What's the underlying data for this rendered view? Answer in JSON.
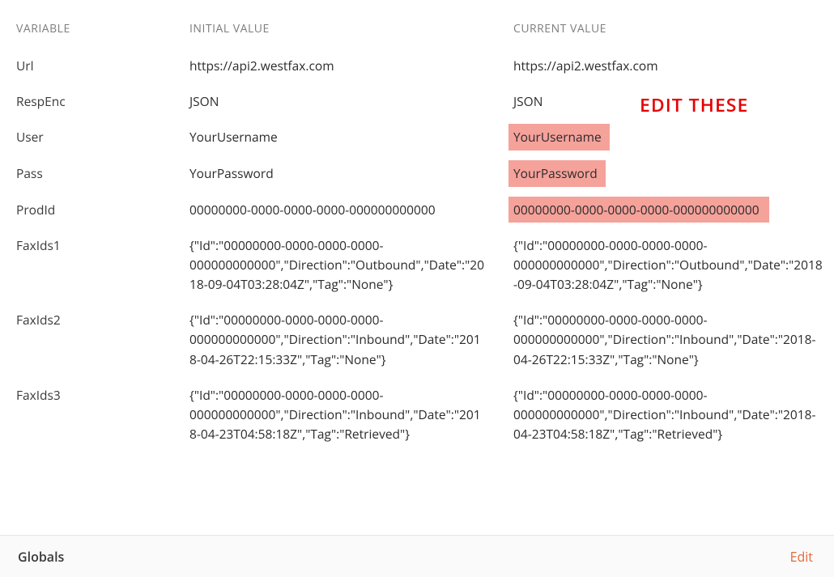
{
  "annotation": "EDIT THESE",
  "headers": {
    "variable": "VARIABLE",
    "initial": "INITIAL VALUE",
    "current": "CURRENT VALUE"
  },
  "rows": [
    {
      "variable": "Url",
      "initial": "https://api2.westfax.com",
      "current": "https://api2.westfax.com",
      "highlight": false
    },
    {
      "variable": "RespEnc",
      "initial": "JSON",
      "current": "JSON",
      "highlight": false
    },
    {
      "variable": "User",
      "initial": "YourUsername",
      "current": "YourUsername",
      "highlight": true
    },
    {
      "variable": "Pass",
      "initial": "YourPassword",
      "current": "YourPassword",
      "highlight": true
    },
    {
      "variable": "ProdId",
      "initial": "00000000-0000-0000-0000-000000000000",
      "current": "00000000-0000-0000-0000-000000000000",
      "highlight": true,
      "wide": true
    },
    {
      "variable": "FaxIds1",
      "initial": "{\"Id\":\"00000000-0000-0000-0000-000000000000\",\"Direction\":\"Outbound\",\"Date\":\"2018-09-04T03:28:04Z\",\"Tag\":\"None\"}",
      "current": "{\"Id\":\"00000000-0000-0000-0000-000000000000\",\"Direction\":\"Outbound\",\"Date\":\"2018-09-04T03:28:04Z\",\"Tag\":\"None\"}",
      "highlight": false
    },
    {
      "variable": "FaxIds2",
      "initial": "{\"Id\":\"00000000-0000-0000-0000-000000000000\",\"Direction\":\"Inbound\",\"Date\":\"2018-04-26T22:15:33Z\",\"Tag\":\"None\"}",
      "current": "{\"Id\":\"00000000-0000-0000-0000-000000000000\",\"Direction\":\"Inbound\",\"Date\":\"2018-04-26T22:15:33Z\",\"Tag\":\"None\"}",
      "highlight": false
    },
    {
      "variable": "FaxIds3",
      "initial": "{\"Id\":\"00000000-0000-0000-0000-000000000000\",\"Direction\":\"Inbound\",\"Date\":\"2018-04-23T04:58:18Z\",\"Tag\":\"Retrieved\"}",
      "current": "{\"Id\":\"00000000-0000-0000-0000-000000000000\",\"Direction\":\"Inbound\",\"Date\":\"2018-04-23T04:58:18Z\",\"Tag\":\"Retrieved\"}",
      "highlight": false
    }
  ],
  "footer": {
    "left": "Globals",
    "right": "Edit"
  }
}
